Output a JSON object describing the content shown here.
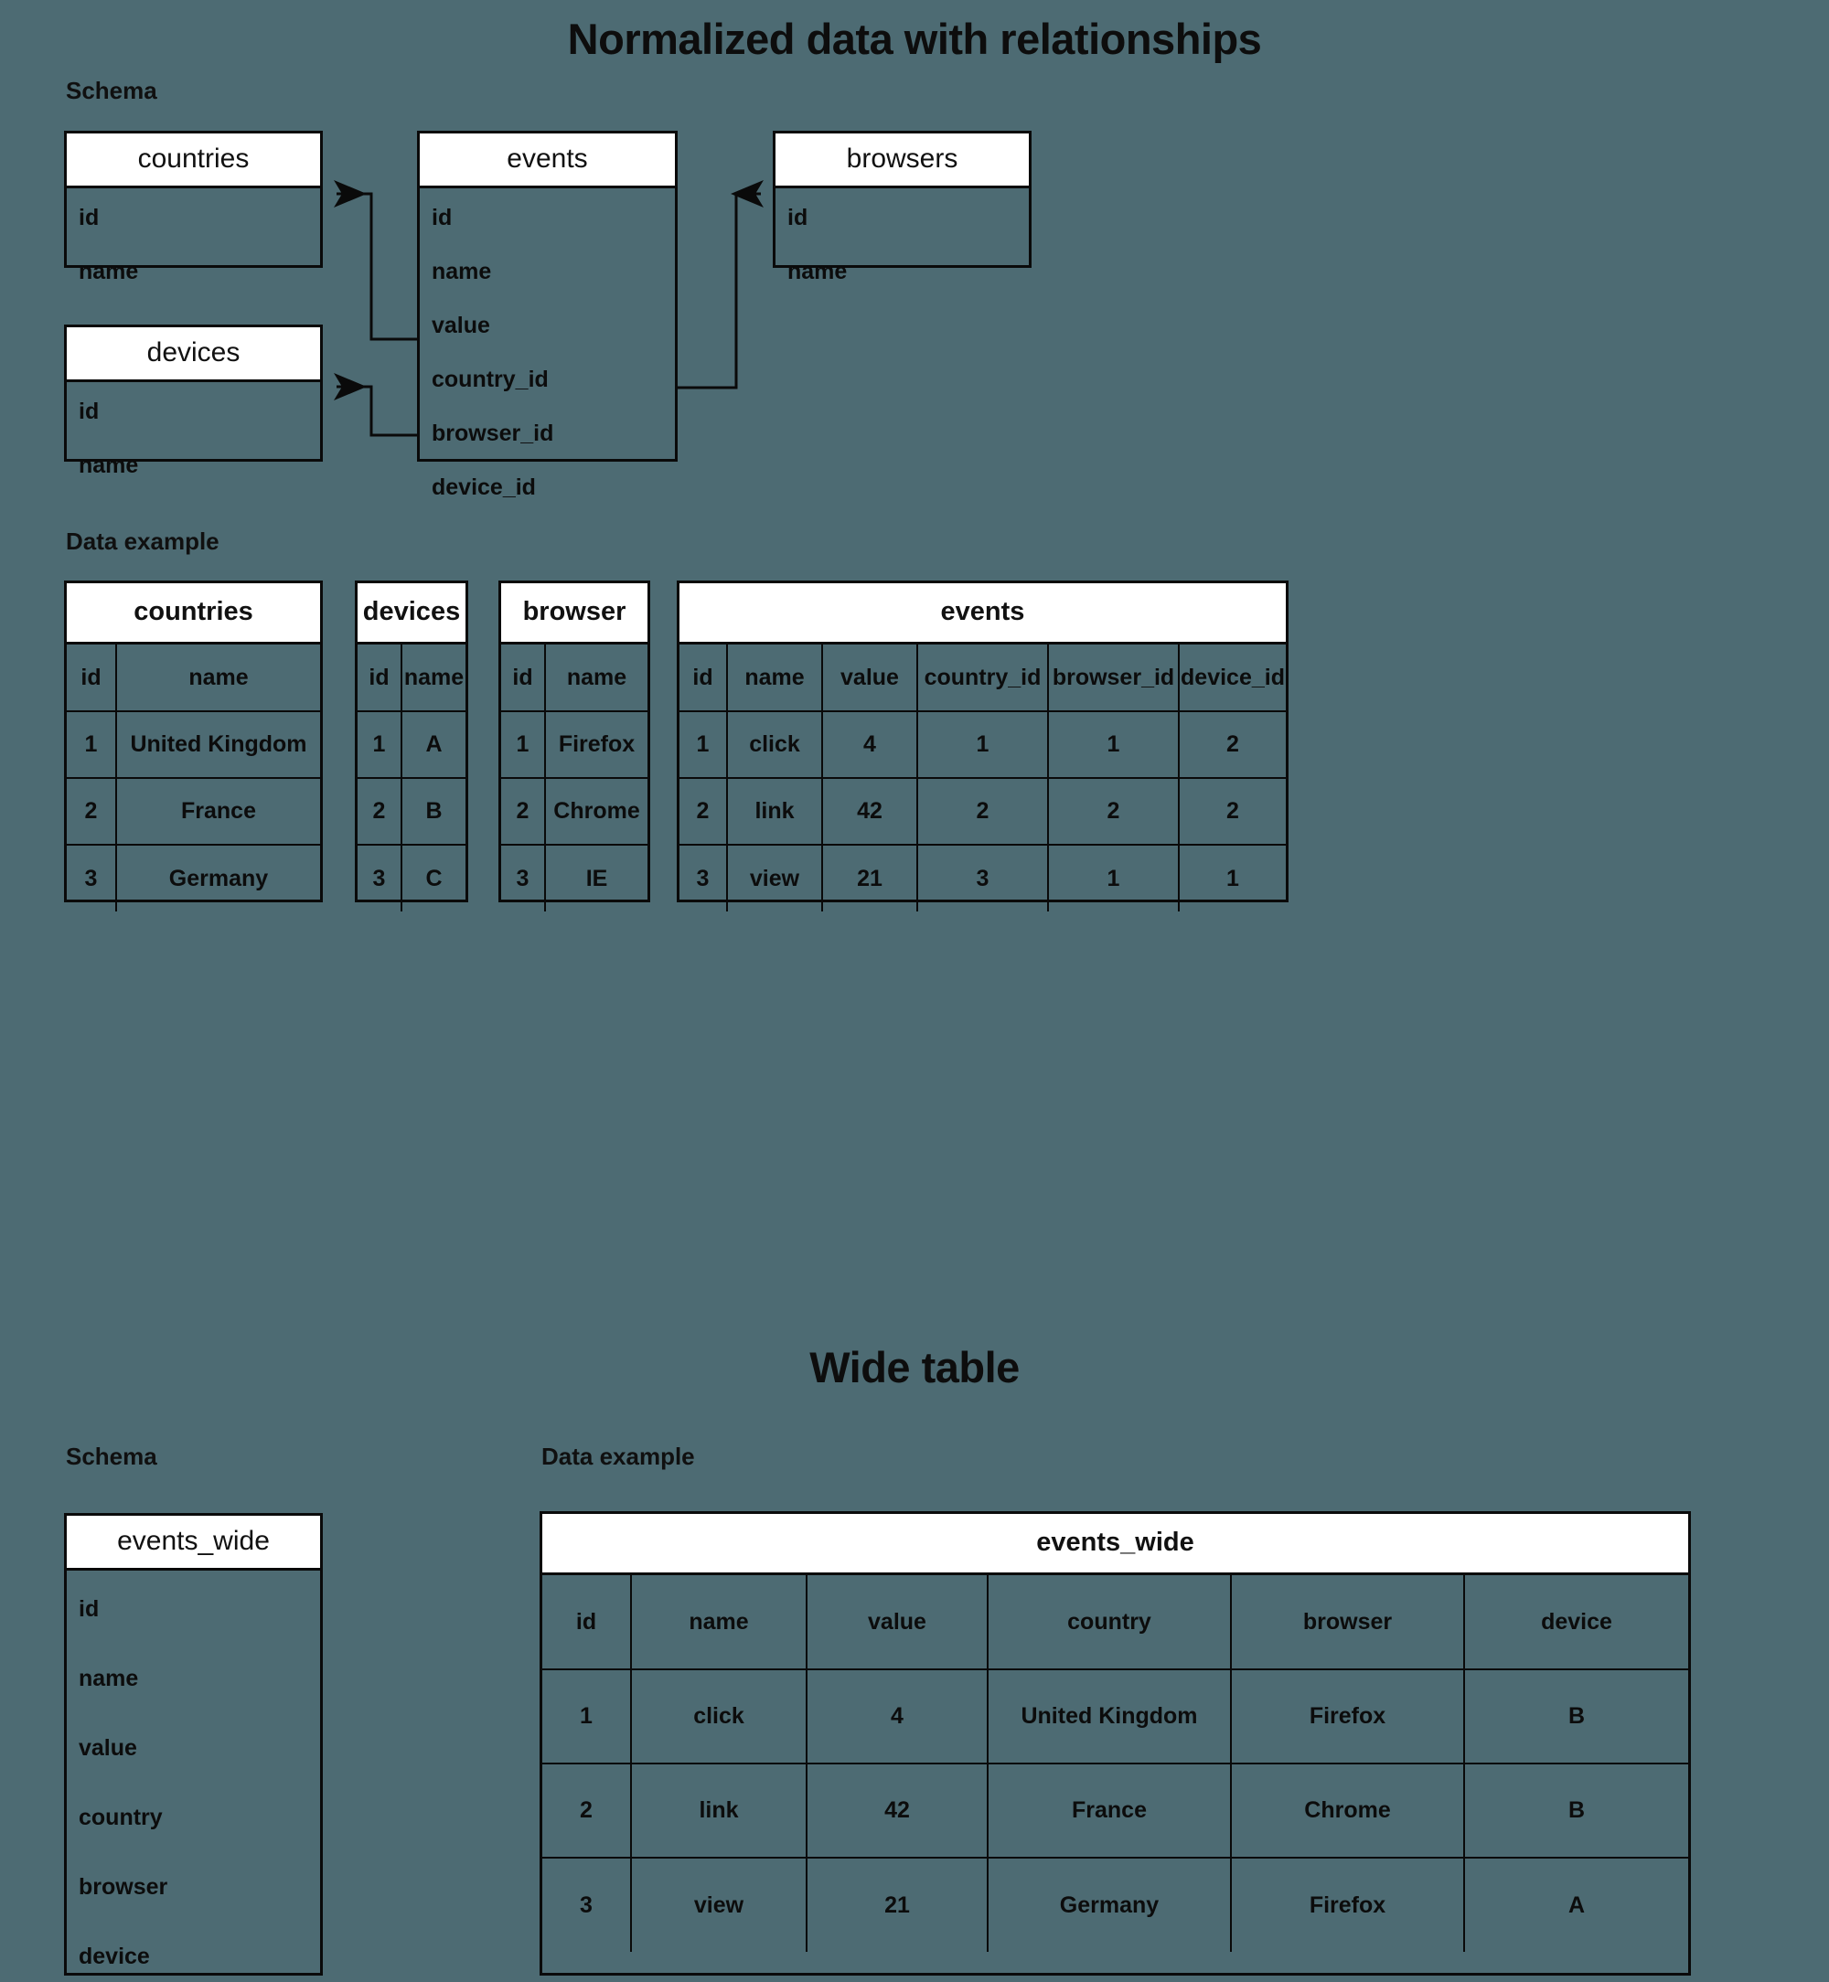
{
  "sections": {
    "normalized": {
      "title": "Normalized data with relationships",
      "schema_label": "Schema",
      "data_label": "Data example"
    },
    "wide": {
      "title": "Wide table",
      "schema_label": "Schema",
      "data_label": "Data example"
    }
  },
  "schema_normalized": {
    "countries": {
      "name": "countries",
      "fields": [
        "id",
        "name"
      ]
    },
    "events": {
      "name": "events",
      "fields": [
        "id",
        "name",
        "value",
        "country_id",
        "browser_id",
        "device_id"
      ]
    },
    "browsers": {
      "name": "browsers",
      "fields": [
        "id",
        "name"
      ]
    },
    "devices": {
      "name": "devices",
      "fields": [
        "id",
        "name"
      ]
    }
  },
  "relationships": [
    {
      "from": "events.country_id",
      "to": "countries.id",
      "direction": "to-countries"
    },
    {
      "from": "events.browser_id",
      "to": "browsers.id",
      "direction": "to-browsers"
    },
    {
      "from": "events.device_id",
      "to": "devices.id",
      "direction": "to-devices"
    }
  ],
  "data_normalized": {
    "countries": {
      "title": "countries",
      "columns": [
        "id",
        "name"
      ],
      "rows": [
        [
          "1",
          "United Kingdom"
        ],
        [
          "2",
          "France"
        ],
        [
          "3",
          "Germany"
        ]
      ]
    },
    "devices": {
      "title": "devices",
      "columns": [
        "id",
        "name"
      ],
      "rows": [
        [
          "1",
          "A"
        ],
        [
          "2",
          "B"
        ],
        [
          "3",
          "C"
        ]
      ]
    },
    "browser": {
      "title": "browser",
      "columns": [
        "id",
        "name"
      ],
      "rows": [
        [
          "1",
          "Firefox"
        ],
        [
          "2",
          "Chrome"
        ],
        [
          "3",
          "IE"
        ]
      ]
    },
    "events": {
      "title": "events",
      "columns": [
        "id",
        "name",
        "value",
        "country_id",
        "browser_id",
        "device_id"
      ],
      "rows": [
        [
          "1",
          "click",
          "4",
          "1",
          "1",
          "2"
        ],
        [
          "2",
          "link",
          "42",
          "2",
          "2",
          "2"
        ],
        [
          "3",
          "view",
          "21",
          "3",
          "1",
          "1"
        ]
      ]
    }
  },
  "schema_wide": {
    "events_wide": {
      "name": "events_wide",
      "fields": [
        "id",
        "name",
        "value",
        "country",
        "browser",
        "device"
      ]
    }
  },
  "data_wide": {
    "events_wide": {
      "title": "events_wide",
      "columns": [
        "id",
        "name",
        "value",
        "country",
        "browser",
        "device"
      ],
      "rows": [
        [
          "1",
          "click",
          "4",
          "United Kingdom",
          "Firefox",
          "B"
        ],
        [
          "2",
          "link",
          "42",
          "France",
          "Chrome",
          "B"
        ],
        [
          "3",
          "view",
          "21",
          "Germany",
          "Firefox",
          "A"
        ]
      ]
    }
  },
  "colors": {
    "background": "#4d6b73",
    "line": "#0a0a0a",
    "header_fill": "#ffffff",
    "text": "#0c0c0c"
  }
}
